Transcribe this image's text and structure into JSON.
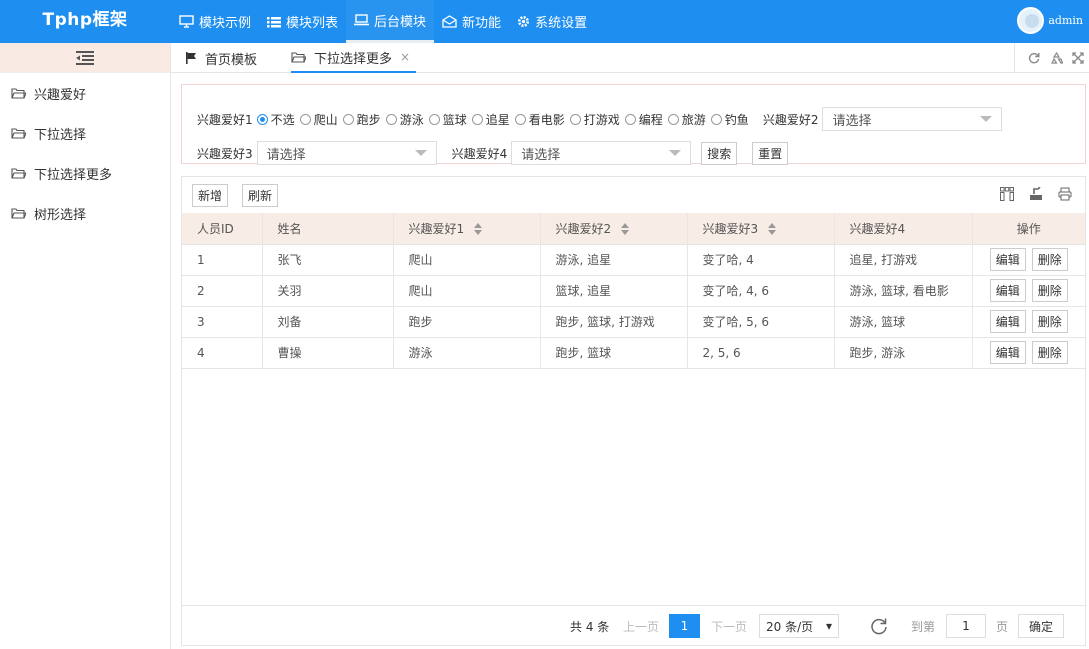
{
  "app": {
    "brand": "Tphp框架",
    "username": "admin"
  },
  "nav": [
    {
      "label": "模块示例",
      "icon": "monitor-icon"
    },
    {
      "label": "模块列表",
      "icon": "list-icon"
    },
    {
      "label": "后台模块",
      "icon": "laptop-icon",
      "active": true
    },
    {
      "label": "新功能",
      "icon": "mail-open-icon"
    },
    {
      "label": "系统设置",
      "icon": "gear-icon"
    }
  ],
  "sidebar": {
    "items": [
      {
        "label": "兴趣爱好"
      },
      {
        "label": "下拉选择"
      },
      {
        "label": "下拉选择更多"
      },
      {
        "label": "树形选择"
      }
    ]
  },
  "tabs": [
    {
      "label": "首页模板",
      "icon": "flag-icon"
    },
    {
      "label": "下拉选择更多",
      "icon": "folder-icon",
      "active": true,
      "close": "×"
    }
  ],
  "search": {
    "hobby1_label": "兴趣爱好1",
    "hobby1_options": [
      "不选",
      "爬山",
      "跑步",
      "游泳",
      "篮球",
      "追星",
      "看电影",
      "打游戏",
      "编程",
      "旅游",
      "钓鱼"
    ],
    "hobby1_selected": "不选",
    "hobby2_label": "兴趣爱好2",
    "hobby2_placeholder": "请选择",
    "hobby3_label": "兴趣爱好3",
    "hobby3_placeholder": "请选择",
    "hobby4_label": "兴趣爱好4",
    "hobby4_placeholder": "请选择",
    "search_btn": "搜索",
    "reset_btn": "重置"
  },
  "toolbar": {
    "add": "新增",
    "refresh": "刷新"
  },
  "table": {
    "headers": [
      "人员ID",
      "姓名",
      "兴趣爱好1",
      "兴趣爱好2",
      "兴趣爱好3",
      "兴趣爱好4",
      "操作"
    ],
    "rows": [
      {
        "id": "1",
        "name": "张飞",
        "h1": "爬山",
        "h2": "游泳, 追星",
        "h3": "变了哈, 4",
        "h4": "追星, 打游戏"
      },
      {
        "id": "2",
        "name": "关羽",
        "h1": "爬山",
        "h2": "篮球, 追星",
        "h3": "变了哈, 4, 6",
        "h4": "游泳, 篮球, 看电影"
      },
      {
        "id": "3",
        "name": "刘备",
        "h1": "跑步",
        "h2": "跑步, 篮球, 打游戏",
        "h3": "变了哈, 5, 6",
        "h4": "游泳, 篮球"
      },
      {
        "id": "4",
        "name": "曹操",
        "h1": "游泳",
        "h2": "跑步, 篮球",
        "h3": "2, 5, 6",
        "h4": "跑步, 游泳"
      }
    ],
    "edit": "编辑",
    "delete": "删除"
  },
  "pager": {
    "total": "共 4 条",
    "prev": "上一页",
    "current": "1",
    "next": "下一页",
    "page_size": "20 条/页",
    "goto_label": "到第",
    "goto_value": "1",
    "page_unit": "页",
    "confirm": "确定"
  },
  "colors": {
    "primary": "#1e8ff0",
    "table_header": "#f8ece6",
    "sidebar_toggle": "#f9ebe3"
  }
}
